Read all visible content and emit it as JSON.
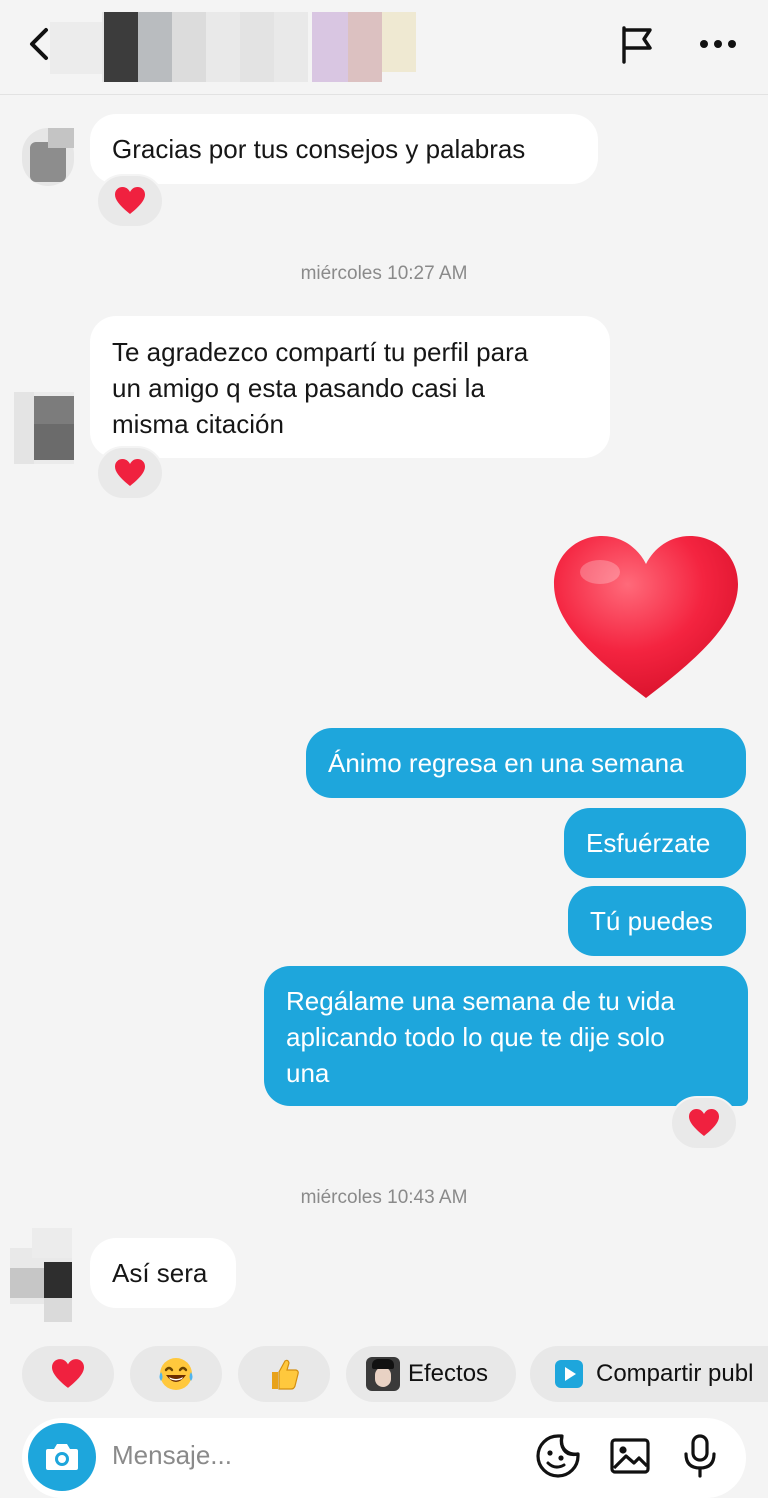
{
  "header": {
    "back_icon": "chevron-left-icon",
    "contact_name": "",
    "flag_icon": "flag-icon",
    "more_icon": "more-horizontal-icon"
  },
  "messages": [
    {
      "side": "in",
      "lines": [
        "Gracias por tus consejos y palabras"
      ],
      "reaction": "red-heart-icon"
    },
    {
      "timestamp": "miércoles 10:27 AM"
    },
    {
      "side": "in",
      "lines": [
        "Te agradezco compartí tu perfil para",
        "un amigo q esta pasando casi la",
        "misma citación"
      ],
      "reaction": "red-heart-icon"
    },
    {
      "side": "out",
      "sticker": "big-heart-icon"
    },
    {
      "side": "out",
      "lines": [
        "Ánimo regresa en una semana"
      ]
    },
    {
      "side": "out",
      "lines": [
        "Esfuérzate"
      ]
    },
    {
      "side": "out",
      "lines": [
        "Tú puedes"
      ]
    },
    {
      "side": "out",
      "lines": [
        "Regálame una semana de tu vida",
        "aplicando todo lo que te dije solo",
        "una"
      ],
      "reaction": "red-heart-icon"
    },
    {
      "timestamp": "miércoles 10:43 AM"
    },
    {
      "side": "in",
      "lines": [
        "Así sera"
      ]
    }
  ],
  "text": {
    "m1_l1": "Gracias por tus consejos y palabras",
    "ts1": "miércoles 10:27 AM",
    "m2_l1": "Te agradezco compartí tu perfil para",
    "m2_l2": "un amigo q esta pasando casi la",
    "m2_l3": "misma citación",
    "o1": "Ánimo regresa en una semana",
    "o2": "Esfuérzate",
    "o3": "Tú puedes",
    "o4_l1": "Regálame una semana de tu vida",
    "o4_l2": "aplicando todo lo que te dije solo",
    "o4_l3": "una",
    "ts2": "miércoles 10:43 AM",
    "m3_l1": "Así sera"
  },
  "quick_bar": {
    "reactions": [
      "red-heart-icon",
      "tears-of-joy-icon",
      "thumbs-up-icon"
    ],
    "effects_label": "Efectos",
    "share_label": "Compartir publ"
  },
  "composer": {
    "placeholder": "Mensaje...",
    "camera_icon": "camera-icon",
    "sticker_icon": "sticker-icon",
    "gallery_icon": "image-icon",
    "mic_icon": "microphone-icon"
  },
  "colors": {
    "outgoing_bubble": "#1ea6dc",
    "incoming_bubble": "#ffffff",
    "background": "#f4f4f4",
    "heart": "#f0213f"
  }
}
